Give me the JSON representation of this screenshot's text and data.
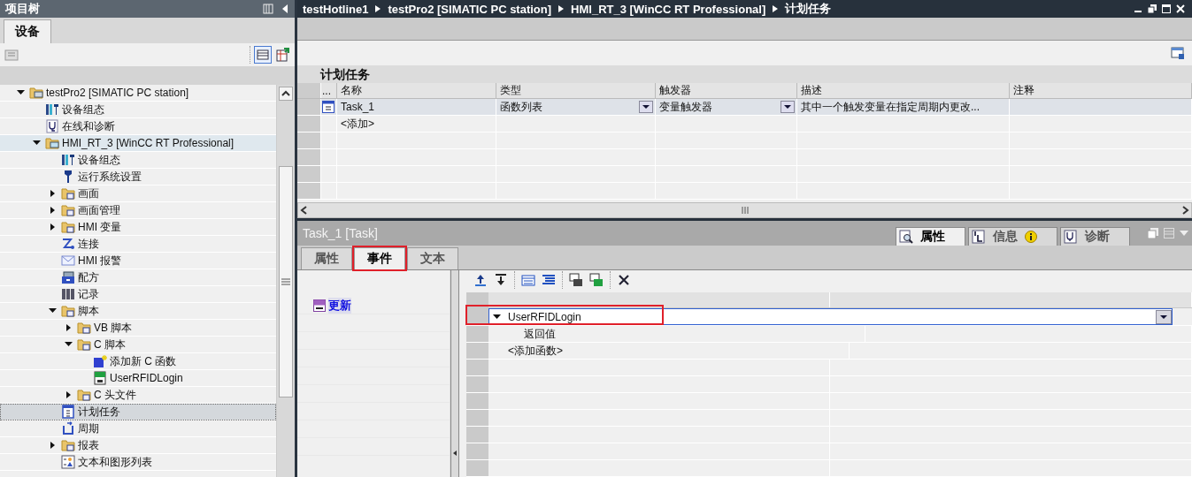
{
  "project_tree": {
    "title": "项目树",
    "tabs": [
      {
        "label": "设备",
        "selected": true
      }
    ],
    "items": [
      {
        "label": "testPro2 [SIMATIC PC station]",
        "kind": "station",
        "expanded": true,
        "selected": false,
        "children": [
          {
            "label": "设备组态",
            "kind": "config",
            "selected": false
          },
          {
            "label": "在线和诊断",
            "kind": "diag",
            "selected": false
          },
          {
            "label": "HMI_RT_3 [WinCC RT Professional]",
            "kind": "hmi",
            "expanded": true,
            "selected": false,
            "focused": true,
            "children": [
              {
                "label": "设备组态",
                "kind": "config",
                "selected": false
              },
              {
                "label": "运行系统设置",
                "kind": "wrench",
                "selected": false
              },
              {
                "label": "画面",
                "kind": "folder",
                "expanded": false,
                "selected": false
              },
              {
                "label": "画面管理",
                "kind": "folder",
                "expanded": false,
                "selected": false
              },
              {
                "label": "HMI 变量",
                "kind": "folder",
                "expanded": false,
                "selected": false
              },
              {
                "label": "连接",
                "kind": "connection",
                "selected": false
              },
              {
                "label": "HMI 报警",
                "kind": "envelope",
                "selected": false
              },
              {
                "label": "配方",
                "kind": "tray",
                "selected": false
              },
              {
                "label": "记录",
                "kind": "binders",
                "selected": false
              },
              {
                "label": "脚本",
                "kind": "folder",
                "expanded": true,
                "selected": false,
                "children": [
                  {
                    "label": "VB 脚本",
                    "kind": "folder",
                    "expanded": false,
                    "selected": false
                  },
                  {
                    "label": "C 脚本",
                    "kind": "folder",
                    "expanded": true,
                    "selected": false,
                    "children": [
                      {
                        "label": "添加新 C 函数",
                        "kind": "new",
                        "selected": false
                      },
                      {
                        "label": "UserRFIDLogin",
                        "kind": "cfile",
                        "selected": false
                      }
                    ]
                  },
                  {
                    "label": "C 头文件",
                    "kind": "folder",
                    "expanded": false,
                    "selected": false
                  }
                ]
              },
              {
                "label": "计划任务",
                "kind": "calendar",
                "selected": true
              },
              {
                "label": "周期",
                "kind": "cycle",
                "selected": false
              },
              {
                "label": "报表",
                "kind": "folder",
                "expanded": false,
                "selected": false
              },
              {
                "label": "文本和图形列表",
                "kind": "list",
                "selected": false
              }
            ]
          }
        ]
      }
    ]
  },
  "breadcrumb": [
    "testHotline1",
    "testPro2 [SIMATIC PC station]",
    "HMI_RT_3 [WinCC RT Professional]",
    "计划任务"
  ],
  "schedule": {
    "title": "计划任务",
    "columns": [
      "...",
      "名称",
      "类型",
      "触发器",
      "描述",
      "注释"
    ],
    "rows": [
      {
        "kind": "task",
        "selected": true,
        "cells": [
          {
            "text": ""
          },
          {
            "text": "Task_1"
          },
          {
            "text": "函数列表",
            "dropdown": true
          },
          {
            "text": "变量触发器",
            "dropdown": true
          },
          {
            "text": "其中一个触发变量在指定周期内更改..."
          }
        ]
      },
      {
        "kind": "add",
        "selected": false,
        "cells": [
          {
            "text": ""
          },
          {
            "text": "<添加>"
          }
        ]
      }
    ]
  },
  "inspector": {
    "title": "Task_1 [Task]",
    "panel_tabs": [
      {
        "label": "属性",
        "kind": "properties",
        "selected": true
      },
      {
        "label": "信息",
        "kind": "info",
        "selected": false
      },
      {
        "label": "诊断",
        "kind": "diagnostics",
        "selected": false
      }
    ],
    "tabs": [
      {
        "label": "属性",
        "selected": false,
        "marked": false
      },
      {
        "label": "事件",
        "selected": true,
        "marked": true
      },
      {
        "label": "文本",
        "selected": false,
        "marked": false
      }
    ],
    "events": [
      {
        "label": "更新",
        "selected": true
      }
    ],
    "functions": [
      {
        "kind": "function",
        "text": "UserRFIDLogin",
        "expanded": true,
        "marked": true
      },
      {
        "kind": "param",
        "text": "返回值"
      },
      {
        "kind": "add",
        "text": "<添加函数>"
      }
    ]
  }
}
